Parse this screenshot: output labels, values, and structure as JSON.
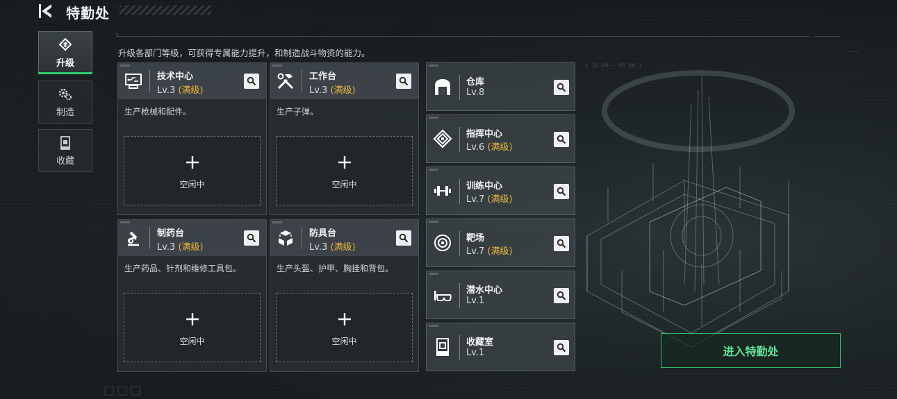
{
  "header": {
    "title": "特勤处",
    "description": "升级各部门等级，可获得专属能力提升，和制造战斗物资的能力。"
  },
  "side_nav": [
    {
      "label": "升级",
      "icon": "upgrade-icon",
      "active": true
    },
    {
      "label": "制造",
      "icon": "gears-icon",
      "active": false
    },
    {
      "label": "收藏",
      "icon": "collection-icon",
      "active": false
    }
  ],
  "departments": [
    {
      "name": "技术中心",
      "level": "Lv.3",
      "max_tag": "(满级)",
      "desc": "生产枪械和配件。",
      "slot_status": "空闲中",
      "icon": "tech-center-icon"
    },
    {
      "name": "工作台",
      "level": "Lv.3",
      "max_tag": "(满级)",
      "desc": "生产子弹。",
      "slot_status": "空闲中",
      "icon": "workbench-icon"
    },
    {
      "name": "制药台",
      "level": "Lv.3",
      "max_tag": "(满级)",
      "desc": "生产药品、针剂和维修工具包。",
      "slot_status": "空闲中",
      "icon": "pharmacy-icon"
    },
    {
      "name": "防具台",
      "level": "Lv.3",
      "max_tag": "(满级)",
      "desc": "生产头盔、护甲、胸挂和背包。",
      "slot_status": "空闲中",
      "icon": "armor-bench-icon"
    }
  ],
  "facilities": [
    {
      "name": "仓库",
      "level": "Lv.8",
      "max_tag": "",
      "icon": "warehouse-icon"
    },
    {
      "name": "指挥中心",
      "level": "Lv.6",
      "max_tag": "(满级)",
      "icon": "command-center-icon"
    },
    {
      "name": "训练中心",
      "level": "Lv.7",
      "max_tag": "(满级)",
      "icon": "training-center-icon"
    },
    {
      "name": "靶场",
      "level": "Lv.7",
      "max_tag": "(满级)",
      "icon": "shooting-range-icon"
    },
    {
      "name": "潜水中心",
      "level": "Lv.1",
      "max_tag": "",
      "icon": "diving-center-icon"
    },
    {
      "name": "收藏室",
      "level": "Lv.1",
      "max_tag": "",
      "icon": "collection-room-icon"
    }
  ],
  "enter_button": "进入特勤处",
  "colors": {
    "accent_green": "#2fbf6a",
    "max_level": "#e9b43b"
  }
}
